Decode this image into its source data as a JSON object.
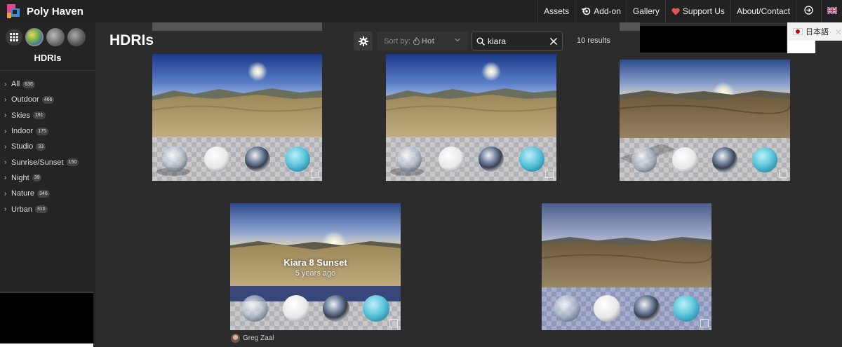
{
  "header": {
    "brand": "Poly Haven",
    "nav": [
      {
        "label": "Assets"
      },
      {
        "label": "Add-on"
      },
      {
        "label": "Gallery"
      },
      {
        "label": "Support Us"
      },
      {
        "label": "About/Contact"
      }
    ]
  },
  "sidebar": {
    "title": "HDRIs",
    "categories": [
      {
        "label": "All",
        "count": "636"
      },
      {
        "label": "Outdoor",
        "count": "466"
      },
      {
        "label": "Skies",
        "count": "191"
      },
      {
        "label": "Indoor",
        "count": "175"
      },
      {
        "label": "Studio",
        "count": "33"
      },
      {
        "label": "Sunrise/Sunset",
        "count": "150"
      },
      {
        "label": "Night",
        "count": "39"
      },
      {
        "label": "Nature",
        "count": "346"
      },
      {
        "label": "Urban",
        "count": "316"
      }
    ]
  },
  "main": {
    "title": "HDRIs",
    "sort_label": "Sort by:",
    "sort_value": "Hot",
    "search_value": "kiara",
    "results": "10 results"
  },
  "language": {
    "label": "日本語"
  },
  "cards": [
    {
      "title": "",
      "age": ""
    },
    {
      "title": "",
      "age": ""
    },
    {
      "title": "",
      "age": ""
    },
    {
      "title": "Kiara 8 Sunset",
      "age": "5 years ago",
      "author": "Greg Zaal"
    },
    {
      "title": "",
      "age": ""
    }
  ],
  "colors": {
    "background": "#2c2c2c",
    "topbar": "#222222",
    "sidebar": "#242424",
    "support_heart": "#e25555"
  }
}
